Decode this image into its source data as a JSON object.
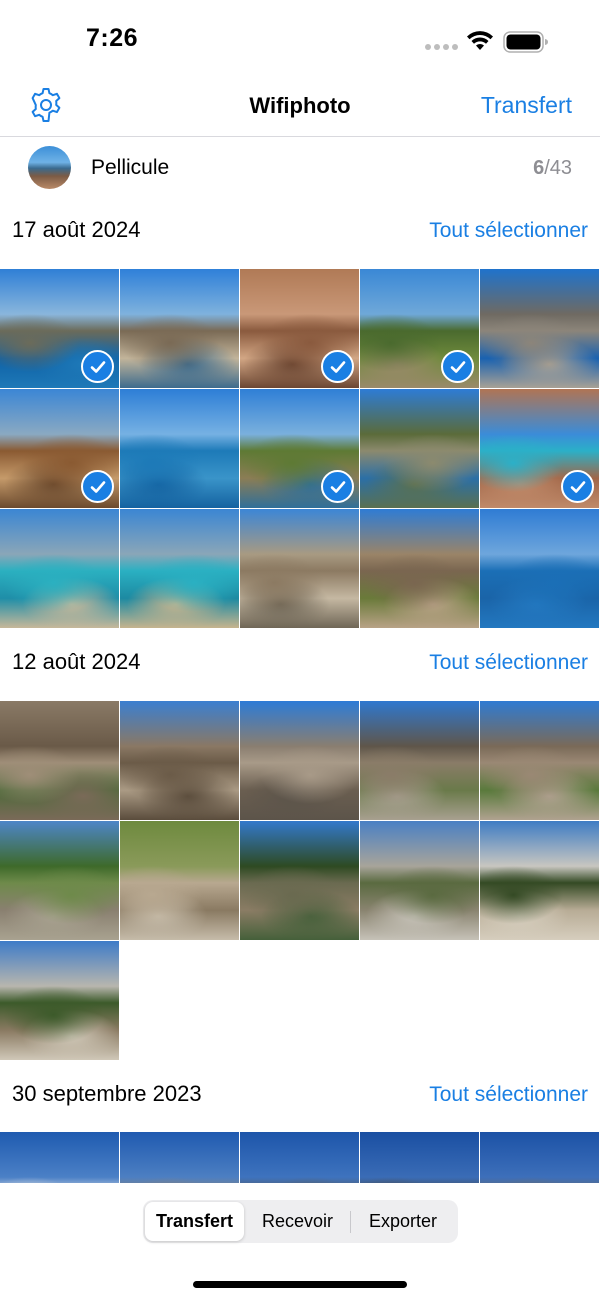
{
  "status_bar": {
    "time": "7:26",
    "icons": [
      "cellular-dots-icon",
      "wifi-icon",
      "battery-icon"
    ]
  },
  "nav": {
    "settings_icon": "gear-icon",
    "title": "Wifiphoto",
    "action_label": "Transfert"
  },
  "album": {
    "name": "Pellicule",
    "selected": "6",
    "separator": "/",
    "total": "43"
  },
  "colors": {
    "accent": "#1a7fe3",
    "secondary_text": "#8e8e93"
  },
  "sections": [
    {
      "date": "17 août 2024",
      "select_all_label": "Tout sélectionner",
      "photos": [
        {
          "desc": "coast-bay",
          "selected": true,
          "colors": [
            "#2f7fd6",
            "#8ab6dc",
            "#6b6b5a",
            "#0f62a6",
            "#1e79b8"
          ]
        },
        {
          "desc": "coastal-path",
          "selected": false,
          "colors": [
            "#2f80d9",
            "#7fb2dd",
            "#7a6a55",
            "#c2b49a",
            "#3d6b8d"
          ]
        },
        {
          "desc": "stone-wall",
          "selected": true,
          "colors": [
            "#b07a56",
            "#c99878",
            "#8a5a3e",
            "#d2a684",
            "#6b4632"
          ]
        },
        {
          "desc": "pine-trees-sea",
          "selected": true,
          "colors": [
            "#3a88d6",
            "#6fa8d8",
            "#4a6a2e",
            "#6f8a3c",
            "#9a8a6a"
          ]
        },
        {
          "desc": "stone-arch",
          "selected": false,
          "colors": [
            "#1f73cc",
            "#6f6a62",
            "#8c857a",
            "#1a62b0",
            "#a8a195"
          ]
        },
        {
          "desc": "dry-tree",
          "selected": true,
          "colors": [
            "#3b86d5",
            "#8aa9c2",
            "#8a5a32",
            "#c59a6a",
            "#6b4a2e"
          ]
        },
        {
          "desc": "blue-sea",
          "selected": false,
          "colors": [
            "#2d7ed6",
            "#76b1e3",
            "#1d7ab8",
            "#3a94c9",
            "#1462a0"
          ]
        },
        {
          "desc": "tree-headland",
          "selected": true,
          "colors": [
            "#2f7fd6",
            "#7ab0dd",
            "#5e7a34",
            "#8b7d55",
            "#2f6f9a"
          ]
        },
        {
          "desc": "bushes-sky",
          "selected": false,
          "colors": [
            "#2d7cd5",
            "#5b6b3a",
            "#8c8a6e",
            "#2b6fa6",
            "#5a7050"
          ]
        },
        {
          "desc": "rock-gap",
          "selected": true,
          "colors": [
            "#b07454",
            "#3b8cd8",
            "#2bb0c8",
            "#a06648",
            "#c08a6a"
          ]
        },
        {
          "desc": "turquoise-bay",
          "selected": false,
          "colors": [
            "#3b86d3",
            "#8aa6b8",
            "#2bb0c0",
            "#1f8ea8",
            "#c7b89a"
          ]
        },
        {
          "desc": "turquoise-bay-2",
          "selected": false,
          "colors": [
            "#3b86d3",
            "#8aa6b8",
            "#2ab0c2",
            "#1d8aa2",
            "#c6b48e"
          ]
        },
        {
          "desc": "stone-village",
          "selected": false,
          "colors": [
            "#3c86d6",
            "#a89a82",
            "#8c7a62",
            "#c5b8a2",
            "#6f6656"
          ]
        },
        {
          "desc": "stone-house",
          "selected": false,
          "colors": [
            "#2f7cd4",
            "#9a8468",
            "#7a6650",
            "#6a7a3a",
            "#b8a286"
          ]
        },
        {
          "desc": "open-sea",
          "selected": false,
          "colors": [
            "#2f7cd4",
            "#6ea6dc",
            "#1b6fb6",
            "#1a64a8",
            "#2378c0"
          ]
        }
      ]
    },
    {
      "date": "12 août 2024",
      "select_all_label": "Tout sélectionner",
      "photos": [
        {
          "desc": "gorge-1",
          "selected": false,
          "colors": [
            "#8a7a66",
            "#6a5a48",
            "#9f8e78",
            "#4e6a3a",
            "#7a6a58"
          ]
        },
        {
          "desc": "gorge-2",
          "selected": false,
          "colors": [
            "#3b7fd0",
            "#8a7864",
            "#6b5b48",
            "#aa9a84",
            "#5a4c3c"
          ]
        },
        {
          "desc": "gorge-cliff",
          "selected": false,
          "colors": [
            "#2d7bd6",
            "#8a7e70",
            "#a89a88",
            "#6a5e50",
            "#5c544a"
          ]
        },
        {
          "desc": "gorge-3",
          "selected": false,
          "colors": [
            "#2f78cf",
            "#5f564a",
            "#8a7c68",
            "#6a7a4a",
            "#a8a090"
          ]
        },
        {
          "desc": "gorge-4",
          "selected": false,
          "colors": [
            "#2f7bd2",
            "#7a6a58",
            "#9a8874",
            "#5a7a3c",
            "#b0a290"
          ]
        },
        {
          "desc": "gorge-forest",
          "selected": false,
          "colors": [
            "#4d86c8",
            "#3e6a2a",
            "#6e8a4a",
            "#8a8070",
            "#a8a290"
          ]
        },
        {
          "desc": "riverbed",
          "selected": false,
          "colors": [
            "#6e8a3e",
            "#8a9a5a",
            "#b8a890",
            "#8a7a62",
            "#c6bcaa"
          ]
        },
        {
          "desc": "trees-trail",
          "selected": false,
          "colors": [
            "#3379cc",
            "#2e4a22",
            "#6a6a50",
            "#8a7c64",
            "#45603a"
          ]
        },
        {
          "desc": "mountain-pines",
          "selected": false,
          "colors": [
            "#4a80c4",
            "#a8a49a",
            "#5a6a40",
            "#8a8470",
            "#c6c2b8"
          ]
        },
        {
          "desc": "trail-tree",
          "selected": false,
          "colors": [
            "#3e7cc4",
            "#c8c6c0",
            "#344a24",
            "#b8ac96",
            "#d6cebe"
          ]
        },
        {
          "desc": "mountain-view",
          "selected": false,
          "colors": [
            "#3e7bc8",
            "#b8b6ae",
            "#3c5a2a",
            "#8a7a62",
            "#d0c8b8"
          ]
        }
      ]
    },
    {
      "date": "30 septembre 2023",
      "select_all_label": "Tout sélectionner",
      "photos": [
        {
          "desc": "snow-peaks",
          "selected": false,
          "colors": [
            "#1f5bb0",
            "#4b80c6",
            "#d8dce2",
            "#9aa2ac",
            "#6b7480"
          ]
        },
        {
          "desc": "rock-summit",
          "selected": false,
          "colors": [
            "#1f5ab0",
            "#4d7fc2",
            "#8a8278",
            "#b0a89c",
            "#6e675e"
          ]
        },
        {
          "desc": "ridge-1",
          "selected": false,
          "colors": [
            "#1d55aa",
            "#3e73be",
            "#5a5a5a",
            "#9a9a9a",
            "#6a6a6a"
          ]
        },
        {
          "desc": "ridge-2",
          "selected": false,
          "colors": [
            "#1a4fa2",
            "#3a6cb6",
            "#4a4a4a",
            "#8a8a8a",
            "#5c5c5c"
          ]
        },
        {
          "desc": "ridge-3",
          "selected": false,
          "colors": [
            "#1c52a6",
            "#3d6fba",
            "#6a6a6a",
            "#a0a0a0",
            "#7a7a7a"
          ]
        }
      ]
    }
  ],
  "segments": {
    "items": [
      "Transfert",
      "Recevoir",
      "Exporter"
    ],
    "active": "Transfert"
  }
}
